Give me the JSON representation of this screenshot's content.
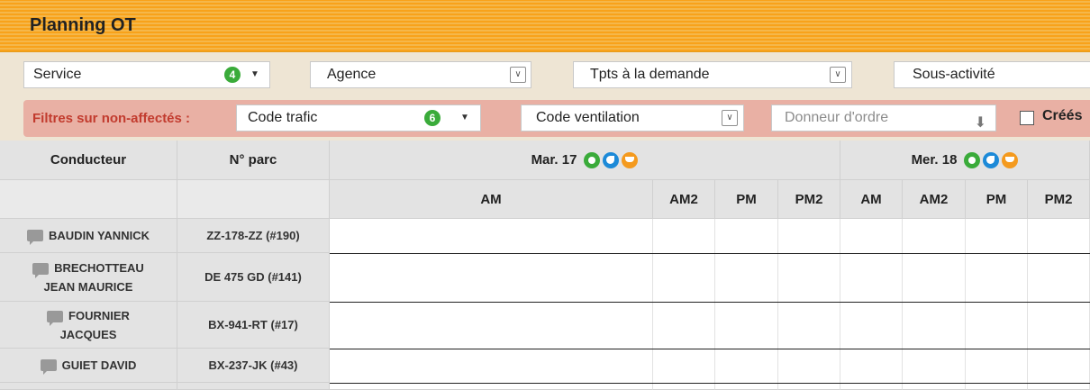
{
  "header": {
    "title": "Planning OT"
  },
  "filters": {
    "service": {
      "label": "Service",
      "badge": "4"
    },
    "agence": {
      "label": "Agence"
    },
    "tpts": {
      "label": "Tpts à la demande"
    },
    "sous_activite": {
      "label": "Sous-activité"
    },
    "non_affectes_label": "Filtres sur non-affectés :",
    "code_trafic": {
      "label": "Code trafic",
      "badge": "6"
    },
    "code_ventilation": {
      "label": "Code ventilation"
    },
    "donneur": {
      "placeholder": "Donneur d'ordre"
    },
    "crees_label": "Créés"
  },
  "grid": {
    "col_conducteur": "Conducteur",
    "col_parc": "N° parc",
    "days": [
      {
        "label": "Mar. 17",
        "slots": [
          "AM",
          "AM2",
          "PM",
          "PM2"
        ]
      },
      {
        "label": "Mer. 18",
        "slots": [
          "AM",
          "AM2",
          "PM",
          "PM2"
        ]
      }
    ],
    "rows": [
      {
        "name_line1": "BAUDIN YANNICK",
        "name_line2": "",
        "parc": "ZZ-178-ZZ (#190)"
      },
      {
        "name_line1": "BRECHOTTEAU",
        "name_line2": "JEAN MAURICE",
        "parc": "DE 475 GD (#141)"
      },
      {
        "name_line1": "FOURNIER",
        "name_line2": "JACQUES",
        "parc": "BX-941-RT (#17)"
      },
      {
        "name_line1": "GUIET DAVID",
        "name_line2": "",
        "parc": "BX-237-JK (#43)"
      }
    ]
  },
  "colors": {
    "title_bar": "#f8a21a",
    "filter_bg": "#eee5d4",
    "filter_red": "#e9b0a4",
    "badge_green": "#3aab3a"
  }
}
